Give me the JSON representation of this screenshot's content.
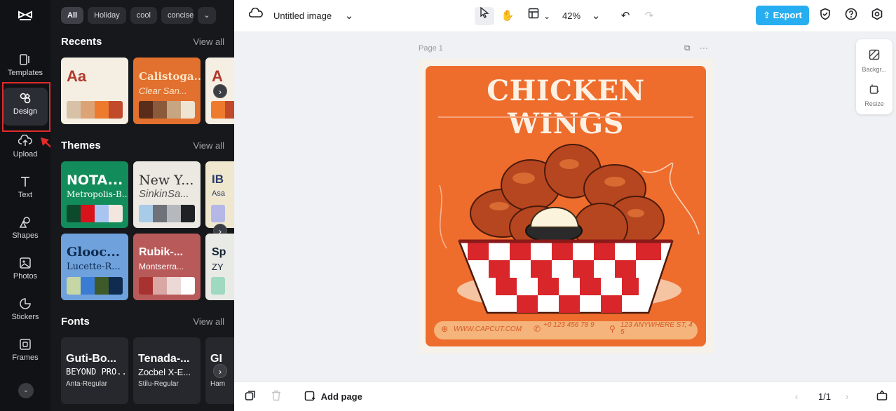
{
  "rail": {
    "items": [
      {
        "label": "Templates"
      },
      {
        "label": "Design"
      },
      {
        "label": "Upload"
      },
      {
        "label": "Text"
      },
      {
        "label": "Shapes"
      },
      {
        "label": "Photos"
      },
      {
        "label": "Stickers"
      },
      {
        "label": "Frames"
      }
    ]
  },
  "panel": {
    "chips": [
      "All",
      "Holiday",
      "cool",
      "concise"
    ],
    "recents": {
      "title": "Recents",
      "view_all": "View all",
      "cards": [
        {
          "big": "Aa",
          "sub": "",
          "colors": [
            "#d7c2a8",
            "#dca476",
            "#ee7a2e",
            "#c14a2b"
          ],
          "bg": "#f5efe3",
          "fg": "#b0392b"
        },
        {
          "big": "Calistoga...",
          "sub": "Clear San...",
          "colors": [
            "#5a2d1a",
            "#8a5a3a",
            "#c6a582",
            "#efe3d2"
          ],
          "bg": "#e2702e",
          "fg": "#fde5c9"
        },
        {
          "big": "A",
          "sub": "",
          "colors": [
            "#ee7a2e",
            "#c14a2b"
          ],
          "bg": "#f5efe3",
          "fg": "#b0392b"
        }
      ]
    },
    "themes": {
      "title": "Themes",
      "view_all": "View all",
      "cards": [
        {
          "big": "NOTA...",
          "sub": "Metropolis-B...",
          "colors": [
            "#0d4a2b",
            "#d9131c",
            "#a9c4f0",
            "#f2e6df"
          ],
          "bg": "#128c5a",
          "fg": "#ffffff"
        },
        {
          "big": "New Y...",
          "sub": "SinkinSa...",
          "colors": [
            "#a8cbe8",
            "#6f7278",
            "#b5b8bd",
            "#202125"
          ],
          "bg": "#ece9e2",
          "fg": "#333333"
        },
        {
          "big": "IB",
          "sub": "Asa",
          "colors": [
            "#b5b8e6"
          ],
          "bg": "#efe8cf",
          "fg": "#2c3a6c"
        },
        {
          "big": "Glooc...",
          "sub": "Lucette-R...",
          "colors": [
            "#c7d6a5",
            "#3a7cd4",
            "#3e5a2a",
            "#0f2b50"
          ],
          "bg": "#6fa1dc",
          "fg": "#0f2b50"
        },
        {
          "big": "Rubik-...",
          "sub": "Montserra...",
          "colors": [
            "#a8322f",
            "#d9a8a4",
            "#ecd9d6",
            "#ffffff"
          ],
          "bg": "#b95a5a",
          "fg": "#ffffff"
        },
        {
          "big": "Sp",
          "sub": "ZY",
          "colors": [
            "#9fd9c0"
          ],
          "bg": "#e9e9e5",
          "fg": "#123"
        }
      ]
    },
    "fonts": {
      "title": "Fonts",
      "view_all": "View all",
      "cards": [
        {
          "f1": "Guti-Bo...",
          "f2": "BEYOND PRO...",
          "f3": "Anta-Regular"
        },
        {
          "f1": "Tenada-...",
          "f2": "Zocbel X-E...",
          "f3": "Stilu-Regular"
        },
        {
          "f1": "GI",
          "f2": "",
          "f3": "Ham"
        }
      ]
    }
  },
  "topbar": {
    "doc_title": "Untitled image",
    "zoom": "42%",
    "export_label": "Export"
  },
  "canvas": {
    "page_label": "Page 1",
    "poster": {
      "title": "CHICKEN WINGS",
      "website": "WWW.CAPCUT.COM",
      "phone": "+0 123 456 78 9",
      "address": "123 ANYWHERE ST, 4 5"
    },
    "side_tools": [
      {
        "label": "Backgr..."
      },
      {
        "label": "Resize"
      }
    ]
  },
  "bottombar": {
    "add_page": "Add page",
    "page_count": "1/1"
  }
}
